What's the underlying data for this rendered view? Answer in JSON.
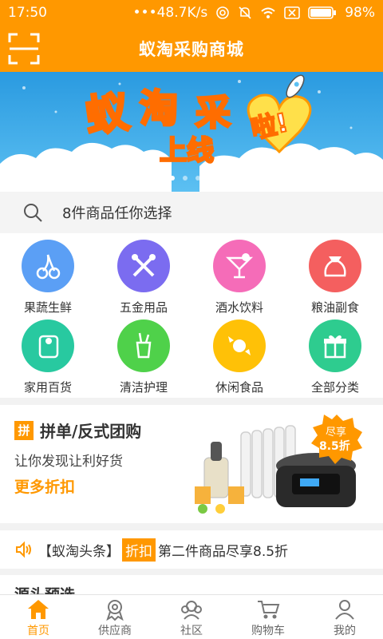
{
  "status": {
    "time": "17:50",
    "network_speed": "48.7K/s",
    "battery": "98%"
  },
  "header": {
    "title": "蚁淘采购商城"
  },
  "banner": {
    "line1a": "蚁",
    "line1b": "淘",
    "line1c": "采",
    "bubble": "啦!",
    "line2": "上线"
  },
  "search": {
    "placeholder": "8件商品任你选择"
  },
  "categories": [
    {
      "label": "果蔬生鲜",
      "color": "#5b9ff5",
      "icon": "cherry-icon"
    },
    {
      "label": "五金用品",
      "color": "#7b6cf0",
      "icon": "tools-icon"
    },
    {
      "label": "酒水饮料",
      "color": "#f56cb8",
      "icon": "cocktail-icon"
    },
    {
      "label": "粮油副食",
      "color": "#f45f5f",
      "icon": "rice-bag-icon"
    },
    {
      "label": "家用百货",
      "color": "#28c9a0",
      "icon": "tissue-icon"
    },
    {
      "label": "清洁护理",
      "color": "#4fd14a",
      "icon": "toothbrush-icon"
    },
    {
      "label": "休闲食品",
      "color": "#ffc107",
      "icon": "candy-icon"
    },
    {
      "label": "全部分类",
      "color": "#2ecc8f",
      "icon": "gift-icon"
    }
  ],
  "group": {
    "tag": "拼",
    "title": "拼单/反式团购",
    "subtitle": "让你发现让利好货",
    "more": "更多折扣",
    "promo_line1": "尽享",
    "promo_line2": "8.5折"
  },
  "headline": {
    "prefix": "【蚁淘头条】",
    "badge": "折扣",
    "text": "第二件商品尽享8.5折"
  },
  "partial_section": {
    "title": "源头预选"
  },
  "tabs": [
    {
      "label": "首页",
      "icon": "home-icon",
      "active": true
    },
    {
      "label": "供应商",
      "icon": "supplier-badge-icon",
      "active": false
    },
    {
      "label": "社区",
      "icon": "community-icon",
      "active": false
    },
    {
      "label": "购物车",
      "icon": "cart-icon",
      "active": false
    },
    {
      "label": "我的",
      "icon": "profile-icon",
      "active": false
    }
  ],
  "colors": {
    "accent": "#ff9800",
    "banner_bg": "#2e9fe0"
  }
}
